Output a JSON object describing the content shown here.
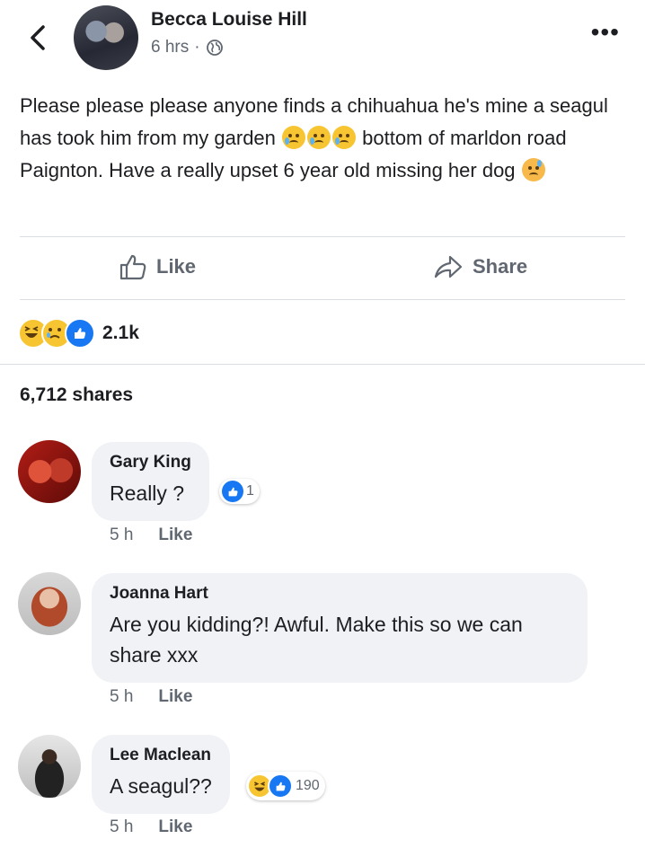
{
  "header": {
    "author_name": "Becca Louise Hill",
    "time": "6 hrs",
    "separator": "·",
    "privacy_icon": "globe-icon",
    "back_icon": "chevron-left-icon",
    "more_icon": "more-dots-icon",
    "more_label": "•••"
  },
  "post": {
    "text_part1": "Please please please anyone finds a chihuahua he's mine a seagul has took him from my garden ",
    "text_part2": " bottom of marldon road Paignton. Have a really upset 6 year old missing her dog ",
    "emoji_icons": [
      "crying-face-icon",
      "crying-face-icon",
      "crying-face-icon",
      "sad-sweat-face-icon"
    ]
  },
  "actions": {
    "like_label": "Like",
    "share_label": "Share",
    "like_icon": "thumbs-up-outline-icon",
    "share_icon": "share-arrow-icon"
  },
  "reactions": {
    "icons": [
      "haha-reaction-icon",
      "sad-reaction-icon",
      "like-reaction-icon"
    ],
    "count": "2.1k"
  },
  "shares": "6,712 shares",
  "comments": [
    {
      "name": "Gary King",
      "text": "Really ?",
      "time": "5 h",
      "like_label": "Like",
      "reaction_count": "1"
    },
    {
      "name": "Joanna Hart",
      "text": "Are you kidding?! Awful. Make this so we can share xxx",
      "time": "5 h",
      "like_label": "Like"
    },
    {
      "name": "Lee Maclean",
      "text": "A seagul??",
      "time": "5 h",
      "like_label": "Like",
      "reaction_count": "190"
    }
  ],
  "colors": {
    "text": "#1c1e21",
    "secondary": "#606770",
    "bubble": "#f0f2f5",
    "like_blue": "#1877f2",
    "emoji_yellow": "#f7c531"
  }
}
